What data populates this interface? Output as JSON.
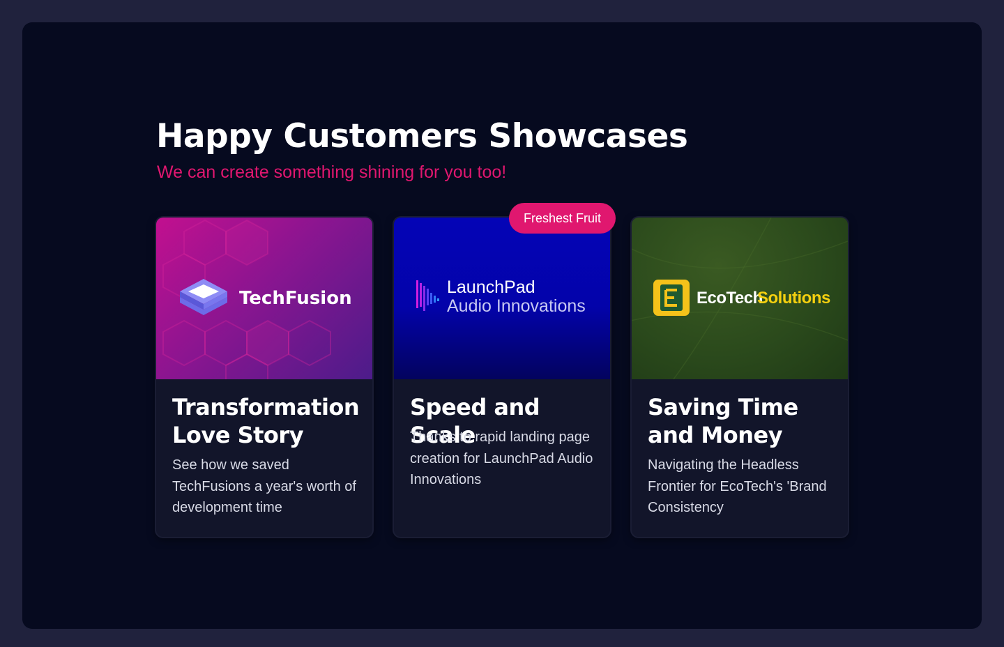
{
  "section": {
    "title": "Happy Customers Showcases",
    "subtitle": "We can create something shining for you too!"
  },
  "badge": {
    "label": "Freshest Fruit"
  },
  "cards": [
    {
      "logo_name": "TechFusion",
      "title": "Transformation Love Story",
      "description": "See how we saved TechFusions a year's worth of development time"
    },
    {
      "logo_line1": "LaunchPad",
      "logo_line2": "Audio Innovations",
      "title": "Speed and Scale",
      "description": "Thanks to rapid landing page creation for LaunchPad Audio Innovations"
    },
    {
      "logo_name_a": "EcoTech",
      "logo_name_b": "Solutions",
      "title": "Saving Time and Money",
      "description": "Navigating the Headless Frontier for EcoTech's 'Brand Consistency"
    }
  ],
  "colors": {
    "page_background": "#20223d",
    "panel_background": "#060a1f",
    "accent_pink": "#e0176f",
    "card_background": "#12152a",
    "ecotech_yellow": "#f5d00f"
  }
}
